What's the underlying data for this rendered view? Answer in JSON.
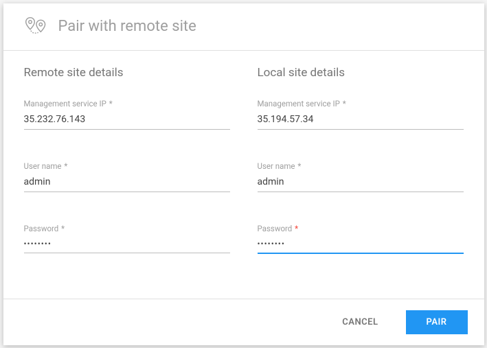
{
  "header": {
    "title": "Pair with remote site",
    "icon_name": "pair-location-icon"
  },
  "remote": {
    "section_title": "Remote site details",
    "ip_label": "Management service IP",
    "ip_value": "35.232.76.143",
    "user_label": "User name",
    "user_value": "admin",
    "password_label": "Password",
    "password_value": "••••••••"
  },
  "local": {
    "section_title": "Local site details",
    "ip_label": "Management service IP",
    "ip_value": "35.194.57.34",
    "user_label": "User name",
    "user_value": "admin",
    "password_label": "Password",
    "password_value": "••••••••"
  },
  "footer": {
    "cancel_label": "Cancel",
    "pair_label": "Pair"
  }
}
